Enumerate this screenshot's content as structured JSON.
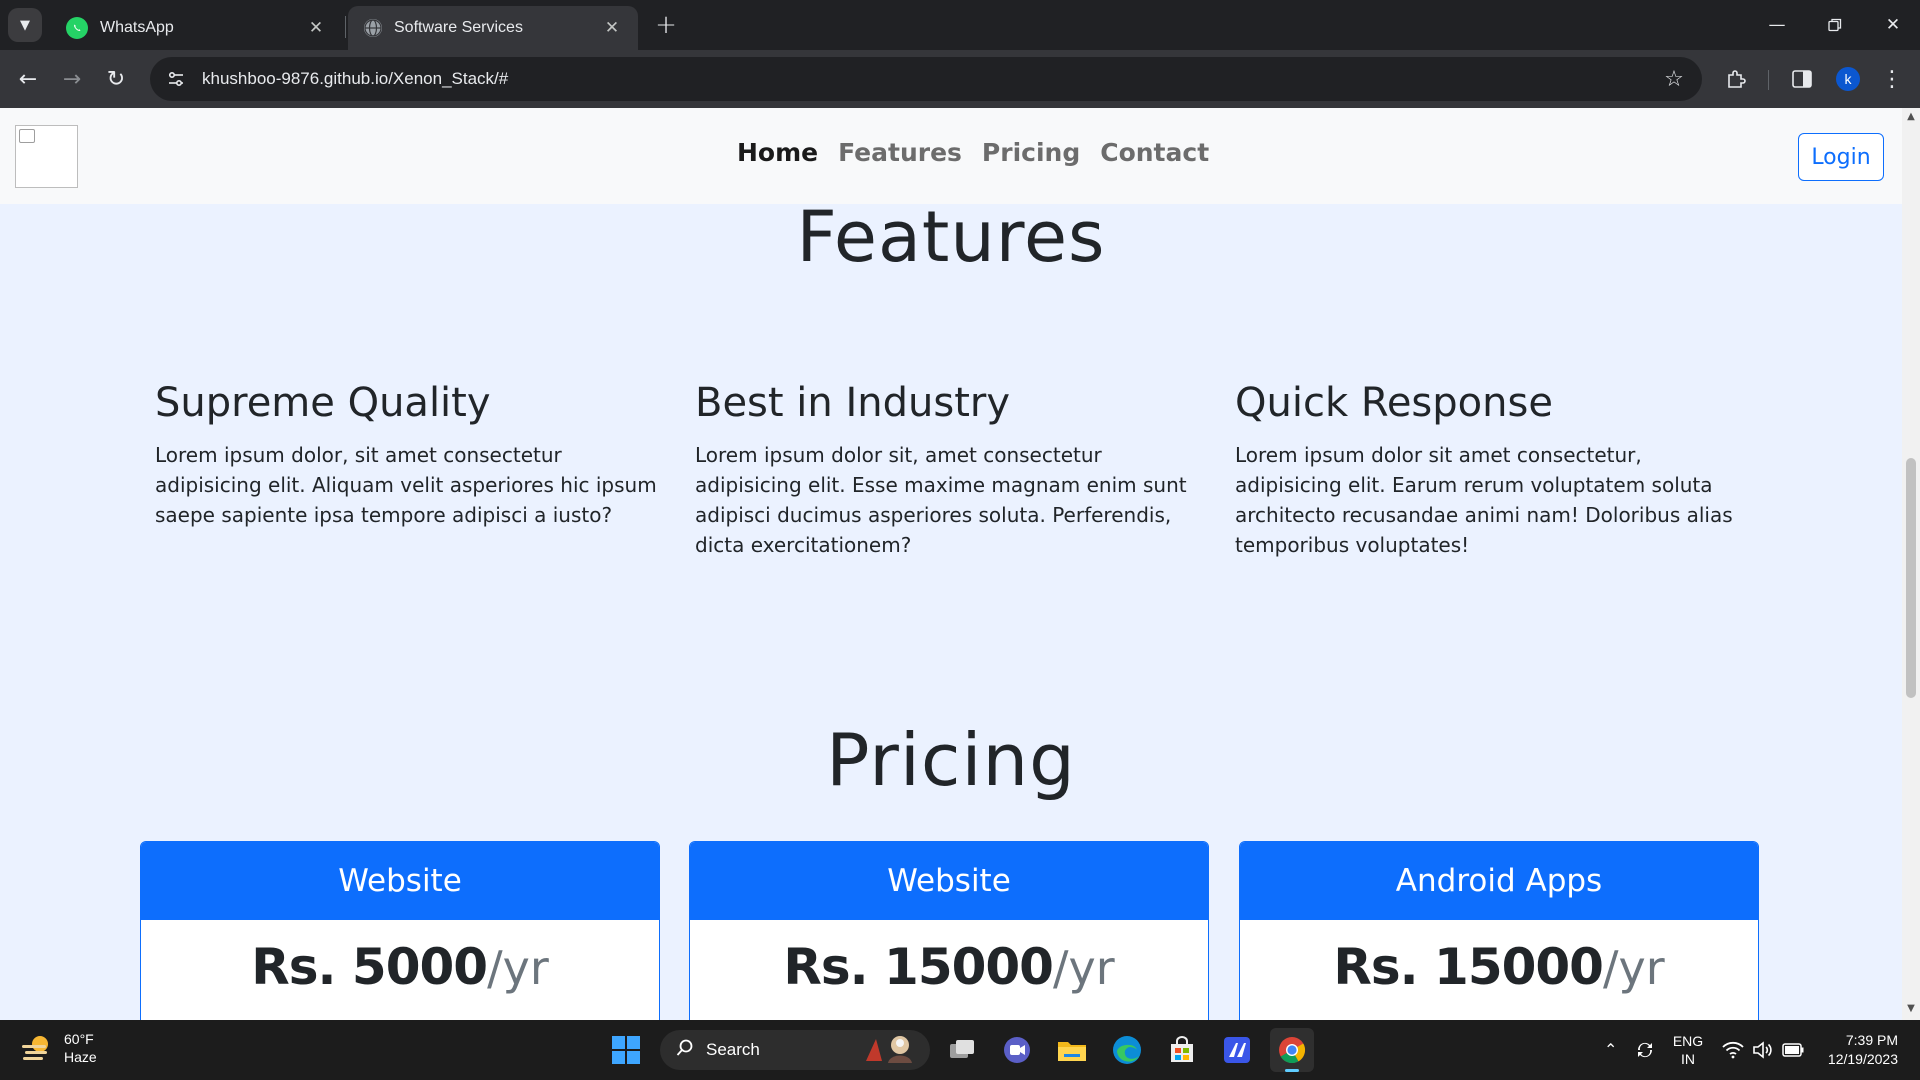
{
  "browser": {
    "tabs": [
      {
        "title": "WhatsApp",
        "icon": "whatsapp-icon"
      },
      {
        "title": "Software Services",
        "icon": "globe-icon"
      }
    ],
    "url": "khushboo-9876.github.io/Xenon_Stack/#",
    "profile_initial": "k"
  },
  "site": {
    "nav": {
      "links": [
        "Home",
        "Features",
        "Pricing",
        "Contact"
      ],
      "active": "Home",
      "login_label": "Login"
    },
    "features": {
      "heading": "Features",
      "items": [
        {
          "title": "Supreme Quality",
          "text": "Lorem ipsum dolor, sit amet consectetur adipisicing elit. Aliquam velit asperiores hic ipsum saepe sapiente ipsa tempore adipisci a iusto?"
        },
        {
          "title": "Best in Industry",
          "text": "Lorem ipsum dolor sit, amet consectetur adipisicing elit. Esse maxime magnam enim sunt adipisci ducimus asperiores soluta. Perferendis, dicta exercitationem?"
        },
        {
          "title": "Quick Response",
          "text": "Lorem ipsum dolor sit amet consectetur, adipisicing elit. Earum rerum voluptatem soluta architecto recusandae animi nam! Doloribus alias temporibus voluptates!"
        }
      ]
    },
    "pricing": {
      "heading": "Pricing",
      "plans": [
        {
          "name": "Website",
          "price": "Rs. 5000",
          "period": "/yr"
        },
        {
          "name": "Website",
          "price": "Rs. 15000",
          "period": "/yr"
        },
        {
          "name": "Android Apps",
          "price": "Rs. 15000",
          "period": "/yr"
        }
      ]
    }
  },
  "taskbar": {
    "weather": {
      "temp": "60°F",
      "condition": "Haze"
    },
    "search_label": "Search",
    "language": {
      "line1": "ENG",
      "line2": "IN"
    },
    "clock": {
      "time": "7:39 PM",
      "date": "12/19/2023"
    }
  },
  "colors": {
    "accent": "#0d6efd",
    "page_bg": "#ebf2ff",
    "navbar_bg": "#f8f9fa",
    "chrome_bg": "#202124",
    "taskbar_bg": "#1c1c1c"
  }
}
